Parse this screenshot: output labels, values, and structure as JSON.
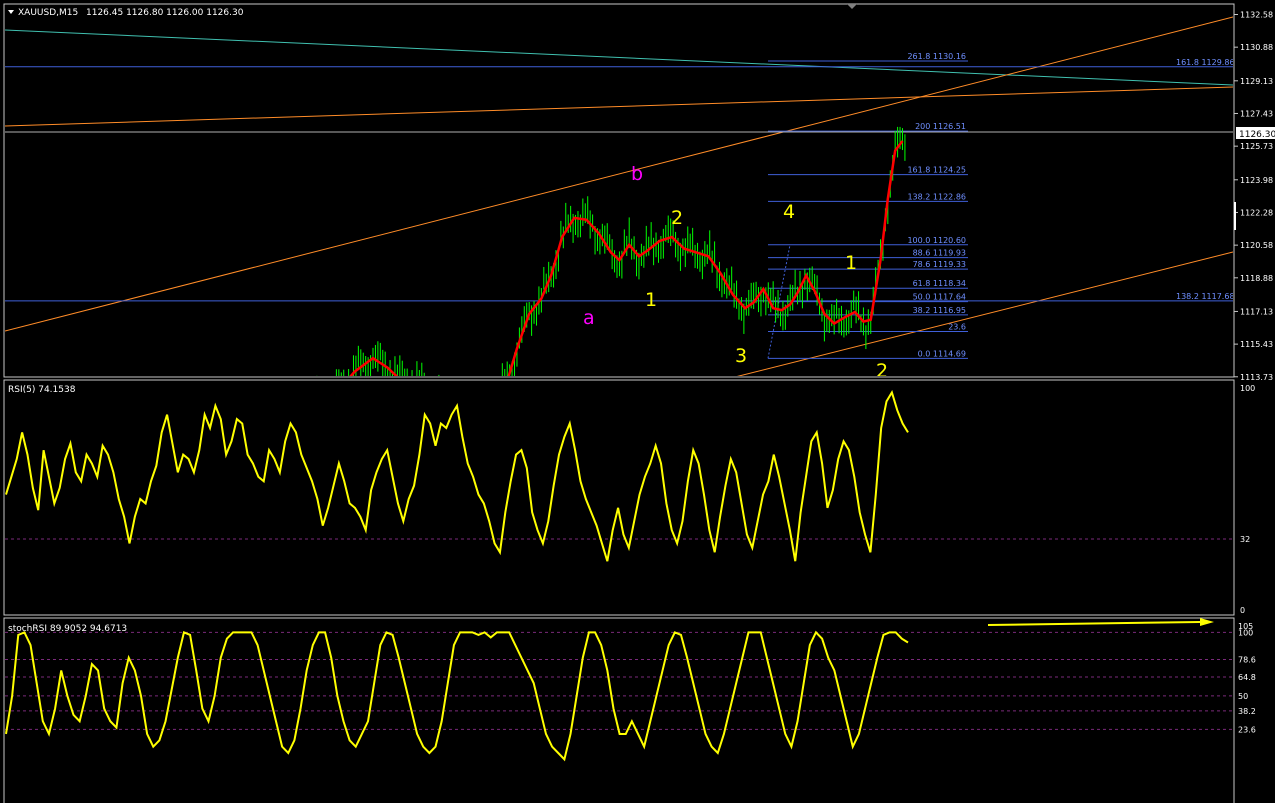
{
  "header": {
    "symbol": "XAUUSD,M15",
    "ohlc": "1126.45 1126.80 1126.00 1126.30",
    "current_price": "1126.30"
  },
  "price_axis": [
    "1132.58",
    "1130.88",
    "1129.13",
    "1127.43",
    "1125.73",
    "1123.98",
    "1122.28",
    "1120.58",
    "1118.88",
    "1117.13",
    "1115.43",
    "1113.73"
  ],
  "fib_right": [
    {
      "text": "261.8 1130.16",
      "price": 1130.16
    },
    {
      "text": "200 1126.51",
      "price": 1126.51
    },
    {
      "text": "161.8 1124.25",
      "price": 1124.25
    },
    {
      "text": "138.2 1122.86",
      "price": 1122.86
    },
    {
      "text": "100.0 1120.60",
      "price": 1120.6
    },
    {
      "text": "88.6 1119.93",
      "price": 1119.93
    },
    {
      "text": "78.6 1119.33",
      "price": 1119.33
    },
    {
      "text": "61.8 1118.34",
      "price": 1118.34
    },
    {
      "text": "50.0 1117.64",
      "price": 1117.64
    },
    {
      "text": "38.2 1116.95",
      "price": 1116.95
    },
    {
      "text": "23.6",
      "price": 1116.09
    },
    {
      "text": "0.0 1114.69",
      "price": 1114.69
    }
  ],
  "fib_long": [
    {
      "text": "161.8 1129.86",
      "price": 1129.86
    },
    {
      "text": "138.2 1117.68",
      "price": 1117.68
    }
  ],
  "wave_labels": [
    {
      "text": "b",
      "color": "#ff00ff"
    },
    {
      "text": "a",
      "color": "#ff00ff"
    },
    {
      "text": "2",
      "color": "#ffff00"
    },
    {
      "text": "1",
      "color": "#ffff00"
    },
    {
      "text": "3",
      "color": "#ffff00"
    },
    {
      "text": "4",
      "color": "#ffff00"
    },
    {
      "text": "1",
      "color": "#ffff00"
    },
    {
      "text": "2",
      "color": "#ffff00"
    }
  ],
  "rsi": {
    "title": "RSI(5) 74.1538",
    "levels": [
      "100",
      "32",
      "0"
    ]
  },
  "stoch": {
    "title": "stochRSI 89.9052 94.6713",
    "levels": [
      "105",
      "100",
      "78.6",
      "64.8",
      "50",
      "38.2",
      "23.6"
    ]
  },
  "colors": {
    "background": "#000000",
    "candles": "#00ff00",
    "moving_average": "#ff0000",
    "indicator": "#ffff00",
    "fib_lines": "#3f5fd8",
    "trendline": "#ff8c28",
    "long_channel": "#40c0b0",
    "axis_text": "#ffffff"
  },
  "chart_data": [
    {
      "type": "candlestick",
      "title": "XAUUSD,M15",
      "ylim": [
        1113.73,
        1132.58
      ],
      "ma_series": [
        [
          0,
          1112.6
        ],
        [
          20,
          1112.9
        ],
        [
          35,
          1114.0
        ],
        [
          50,
          1114.7
        ],
        [
          62,
          1114.2
        ],
        [
          72,
          1113.6
        ],
        [
          85,
          1113.4
        ],
        [
          100,
          1112.8
        ],
        [
          120,
          1112.3
        ],
        [
          140,
          1112.1
        ],
        [
          150,
          1112.4
        ],
        [
          160,
          1113.5
        ],
        [
          168,
          1115.2
        ],
        [
          178,
          1117.0
        ],
        [
          188,
          1117.8
        ],
        [
          196,
          1119.0
        ],
        [
          205,
          1121.0
        ],
        [
          215,
          1122.0
        ],
        [
          225,
          1121.9
        ],
        [
          235,
          1121.2
        ],
        [
          245,
          1120.2
        ],
        [
          252,
          1119.8
        ],
        [
          260,
          1120.6
        ],
        [
          268,
          1120.0
        ],
        [
          275,
          1120.3
        ],
        [
          285,
          1120.8
        ],
        [
          295,
          1121.0
        ],
        [
          305,
          1120.4
        ],
        [
          315,
          1120.2
        ],
        [
          325,
          1120.0
        ],
        [
          335,
          1119.1
        ],
        [
          345,
          1118.0
        ],
        [
          355,
          1117.3
        ],
        [
          362,
          1117.6
        ],
        [
          370,
          1118.3
        ],
        [
          378,
          1117.3
        ],
        [
          385,
          1117.2
        ],
        [
          392,
          1117.5
        ],
        [
          398,
          1118.1
        ],
        [
          405,
          1119.0
        ],
        [
          412,
          1118.2
        ],
        [
          420,
          1117.0
        ],
        [
          428,
          1116.5
        ],
        [
          436,
          1116.8
        ],
        [
          445,
          1117.1
        ],
        [
          452,
          1116.6
        ],
        [
          458,
          1116.7
        ],
        [
          466,
          1119.8
        ],
        [
          472,
          1123.0
        ],
        [
          478,
          1125.5
        ],
        [
          484,
          1126.0
        ]
      ],
      "wave_labels": [
        "b",
        "a",
        "2",
        "1",
        "3",
        "4",
        "1",
        "2"
      ],
      "fibonacci_levels": [
        {
          "level": "261.8",
          "price": 1130.16
        },
        {
          "level": "200",
          "price": 1126.51
        },
        {
          "level": "161.8",
          "price": 1124.25
        },
        {
          "level": "138.2",
          "price": 1122.86
        },
        {
          "level": "100.0",
          "price": 1120.6
        },
        {
          "level": "88.6",
          "price": 1119.93
        },
        {
          "level": "78.6",
          "price": 1119.33
        },
        {
          "level": "61.8",
          "price": 1118.34
        },
        {
          "level": "50.0",
          "price": 1117.64
        },
        {
          "level": "38.2",
          "price": 1116.95
        },
        {
          "level": "23.6",
          "price": 1116.09
        },
        {
          "level": "0.0",
          "price": 1114.69
        }
      ],
      "fibonacci_long_levels": [
        {
          "level": "161.8",
          "price": 1129.86
        },
        {
          "level": "138.2",
          "price": 1117.68
        }
      ],
      "current_price": 1126.3
    },
    {
      "type": "line",
      "title": "RSI(5) 74.1538",
      "ylim": [
        0,
        100
      ],
      "levels": [
        32
      ],
      "series": [
        {
          "values": [
            52,
            60,
            68,
            80,
            70,
            55,
            45,
            72,
            60,
            48,
            55,
            68,
            75,
            62,
            58,
            70,
            66,
            60,
            74,
            70,
            62,
            50,
            42,
            30,
            42,
            50,
            48,
            58,
            65,
            80,
            88,
            75,
            62,
            70,
            68,
            62,
            72,
            88,
            82,
            92,
            86,
            70,
            76,
            86,
            84,
            70,
            66,
            60,
            58,
            72,
            68,
            62,
            76,
            84,
            80,
            70,
            64,
            58,
            50,
            38,
            46,
            56,
            66,
            58,
            48,
            46,
            42,
            36,
            54,
            62,
            68,
            72,
            60,
            48,
            40,
            50,
            56,
            70,
            88,
            84,
            74,
            84,
            82,
            88,
            92,
            78,
            66,
            60,
            52,
            48,
            40,
            30,
            26,
            44,
            58,
            70,
            72,
            64,
            44,
            36,
            30,
            40,
            56,
            70,
            78,
            84,
            72,
            58,
            50,
            44,
            38,
            30,
            22,
            36,
            46,
            34,
            28,
            40,
            52,
            60,
            66,
            74,
            66,
            48,
            36,
            30,
            40,
            58,
            72,
            66,
            52,
            36,
            26,
            42,
            56,
            68,
            62,
            48,
            34,
            28,
            40,
            52,
            58,
            70,
            60,
            48,
            36,
            22,
            44,
            60,
            76,
            80,
            66,
            46,
            54,
            68,
            76,
            72,
            60,
            44,
            34,
            26,
            52,
            82,
            94,
            98,
            90,
            84,
            80
          ]
        }
      ]
    },
    {
      "type": "line",
      "title": "stochRSI 89.9052 94.6713",
      "ylim": [
        0,
        105
      ],
      "levels": [
        100,
        78.6,
        64.8,
        50,
        38.2,
        23.6
      ],
      "series": [
        {
          "values": [
            20,
            50,
            98,
            100,
            90,
            60,
            30,
            20,
            40,
            70,
            50,
            35,
            30,
            50,
            75,
            70,
            40,
            30,
            25,
            60,
            80,
            70,
            50,
            20,
            10,
            15,
            30,
            55,
            80,
            100,
            98,
            70,
            40,
            30,
            50,
            80,
            95,
            100,
            100,
            100,
            100,
            90,
            70,
            50,
            30,
            10,
            5,
            15,
            40,
            70,
            90,
            100,
            100,
            80,
            50,
            30,
            15,
            10,
            20,
            30,
            60,
            90,
            100,
            98,
            80,
            60,
            40,
            20,
            10,
            5,
            10,
            30,
            60,
            90,
            100,
            100,
            100,
            98,
            100,
            96,
            100,
            100,
            100,
            90,
            80,
            70,
            60,
            40,
            20,
            10,
            5,
            0,
            20,
            50,
            80,
            100,
            100,
            90,
            70,
            40,
            20,
            20,
            30,
            20,
            10,
            30,
            50,
            70,
            90,
            100,
            98,
            80,
            60,
            40,
            20,
            10,
            5,
            20,
            40,
            60,
            80,
            100,
            100,
            100,
            80,
            60,
            40,
            20,
            10,
            30,
            60,
            90,
            100,
            95,
            80,
            70,
            50,
            30,
            10,
            20,
            40,
            60,
            80,
            98,
            100,
            100,
            95,
            92
          ]
        }
      ]
    }
  ]
}
